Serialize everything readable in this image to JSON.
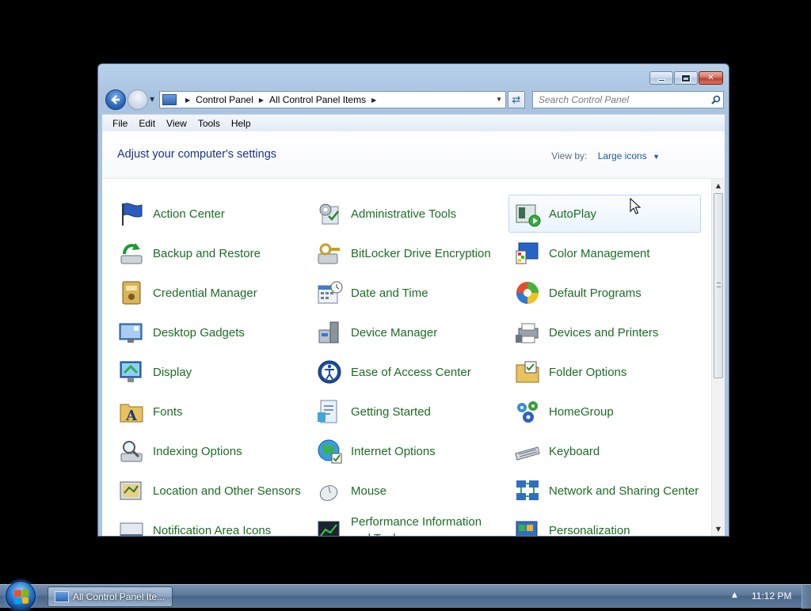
{
  "window": {
    "controls": {
      "minimize": "minimize",
      "maximize": "maximize",
      "close": "✕"
    }
  },
  "address_bar": {
    "crumbs": [
      "Control Panel",
      "All Control Panel Items"
    ]
  },
  "search": {
    "placeholder": "Search Control Panel"
  },
  "menu": [
    "File",
    "Edit",
    "View",
    "Tools",
    "Help"
  ],
  "content": {
    "heading": "Adjust your computer's settings",
    "view_by_label": "View by:",
    "view_by_value": "Large icons"
  },
  "items": [
    {
      "label": "Action Center",
      "icon": "flag-icon"
    },
    {
      "label": "Administrative Tools",
      "icon": "admin-tools-icon"
    },
    {
      "label": "AutoPlay",
      "icon": "autoplay-icon"
    },
    {
      "label": "Backup and Restore",
      "icon": "backup-icon"
    },
    {
      "label": "BitLocker Drive Encryption",
      "icon": "bitlocker-icon"
    },
    {
      "label": "Color Management",
      "icon": "color-management-icon"
    },
    {
      "label": "Credential Manager",
      "icon": "credential-icon"
    },
    {
      "label": "Date and Time",
      "icon": "calendar-clock-icon"
    },
    {
      "label": "Default Programs",
      "icon": "default-programs-icon"
    },
    {
      "label": "Desktop Gadgets",
      "icon": "gadgets-icon"
    },
    {
      "label": "Device Manager",
      "icon": "device-manager-icon"
    },
    {
      "label": "Devices and Printers",
      "icon": "printer-icon"
    },
    {
      "label": "Display",
      "icon": "display-icon"
    },
    {
      "label": "Ease of Access Center",
      "icon": "ease-of-access-icon"
    },
    {
      "label": "Folder Options",
      "icon": "folder-options-icon"
    },
    {
      "label": "Fonts",
      "icon": "fonts-icon"
    },
    {
      "label": "Getting Started",
      "icon": "getting-started-icon"
    },
    {
      "label": "HomeGroup",
      "icon": "homegroup-icon"
    },
    {
      "label": "Indexing Options",
      "icon": "indexing-icon"
    },
    {
      "label": "Internet Options",
      "icon": "internet-options-icon"
    },
    {
      "label": "Keyboard",
      "icon": "keyboard-icon"
    },
    {
      "label": "Location and Other Sensors",
      "icon": "sensors-icon"
    },
    {
      "label": "Mouse",
      "icon": "mouse-icon"
    },
    {
      "label": "Network and Sharing Center",
      "icon": "network-icon"
    },
    {
      "label": "Notification Area Icons",
      "icon": "notification-icon"
    },
    {
      "label": "Performance Information and Tools",
      "icon": "performance-icon"
    },
    {
      "label": "Personalization",
      "icon": "personalization-icon"
    }
  ],
  "hovered_item": "AutoPlay",
  "scrollbar": {
    "position_fraction": 0.0
  },
  "taskbar": {
    "task_label": "All Control Panel Ite...",
    "clock": "11:12 PM"
  },
  "colors": {
    "link_green": "#1b6d24",
    "heading_blue": "#1e3287",
    "window_frame": "#a9c4e1"
  }
}
